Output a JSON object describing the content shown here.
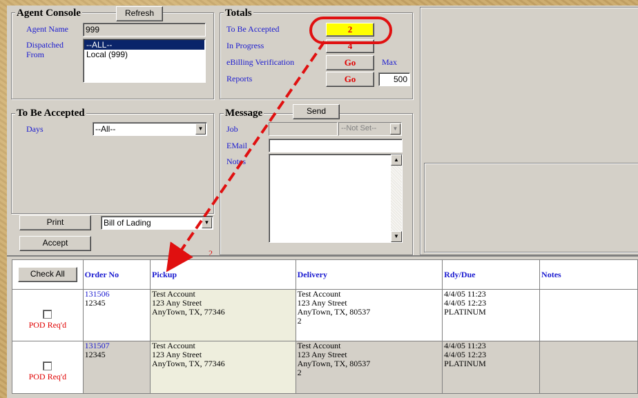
{
  "agent_console": {
    "title": "Agent Console",
    "refresh_label": "Refresh",
    "agent_name_label": "Agent Name",
    "agent_name_value": "999",
    "dispatched_from_label": "Dispatched From",
    "dispatched_options": [
      "--ALL--",
      "Local (999)"
    ]
  },
  "totals": {
    "title": "Totals",
    "to_be_accepted_label": "To Be Accepted",
    "to_be_accepted_value": "2",
    "in_progress_label": "In Progress",
    "in_progress_value": "4",
    "ebilling_label": "eBilling Verification",
    "ebilling_button": "Go",
    "reports_label": "Reports",
    "reports_button": "Go",
    "max_label": "Max",
    "max_value": "500"
  },
  "to_be_accepted": {
    "title": "To Be Accepted",
    "days_label": "Days",
    "days_value": "--All--",
    "print_label": "Print",
    "print_select_value": "Bill of Lading",
    "accept_label": "Accept",
    "count": "2"
  },
  "message": {
    "title": "Message",
    "send_label": "Send",
    "job_label": "Job",
    "job_select": "--Not Set--",
    "email_label": "EMail",
    "notes_label": "Notes"
  },
  "grid": {
    "check_all_label": "Check All",
    "columns": [
      "Order No",
      "Pickup",
      "Delivery",
      "Rdy/Due",
      "Notes"
    ],
    "pod_label": "POD Req'd",
    "rows": [
      {
        "order_no": "131506",
        "ref": "12345",
        "pickup": [
          "Test Account",
          "123 Any Street",
          "AnyTown, TX, 77346"
        ],
        "delivery": [
          "Test Account",
          "123 Any Street",
          "AnyTown, TX, 80537",
          "2"
        ],
        "rdy": [
          "4/4/05 11:23",
          "4/4/05 12:23",
          "PLATINUM"
        ],
        "notes": ""
      },
      {
        "order_no": "131507",
        "ref": "12345",
        "pickup": [
          "Test Account",
          "123 Any Street",
          "AnyTown, TX, 77346"
        ],
        "delivery": [
          "Test Account",
          "123 Any Street",
          "AnyTown, TX, 80537",
          "2"
        ],
        "rdy": [
          "4/4/05 11:23",
          "4/4/05 12:23",
          "PLATINUM"
        ],
        "notes": ""
      }
    ]
  },
  "colors": {
    "annotation": "#e01010",
    "highlight": "#ffff00",
    "link": "#1a1ad0"
  }
}
